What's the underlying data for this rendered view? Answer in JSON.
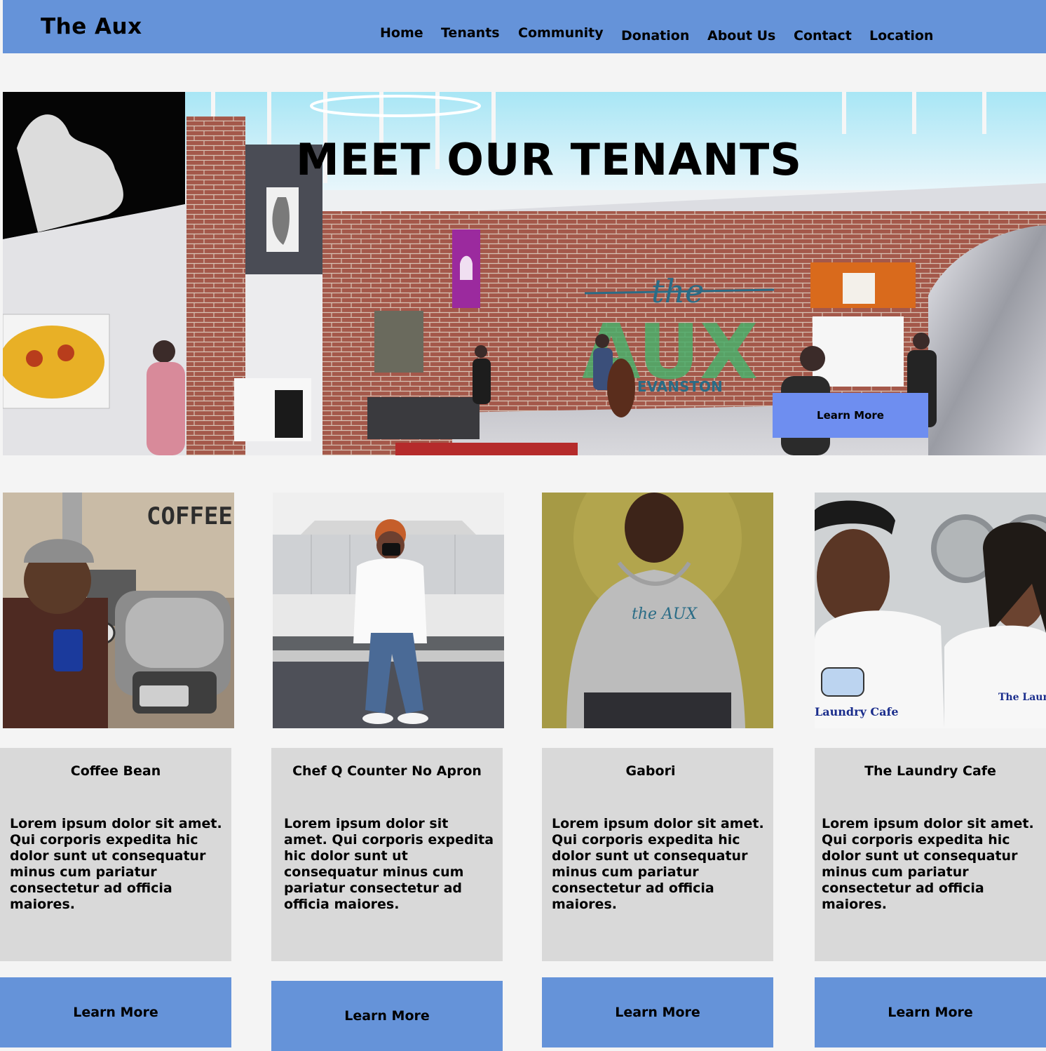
{
  "navbar": {
    "brand": "The Aux",
    "links": [
      "Home",
      "Tenants",
      "Community",
      "Donation",
      "About Us",
      "Contact",
      "Location"
    ]
  },
  "hero": {
    "title": "MEET OUR TENANTS",
    "button_label": "Learn More",
    "signage_text": "the AUX EVANSTON"
  },
  "tenants": [
    {
      "name": "Coffee Bean",
      "description": "Lorem ipsum dolor sit amet. Qui corporis expedita hic dolor sunt ut consequatur minus cum pariatur consectetur ad officia maiores.",
      "button_label": "Learn More",
      "photo_text": "COFFEE RANG"
    },
    {
      "name": "Chef Q Counter No Apron",
      "description": "Lorem ipsum dolor sit amet. Qui corporis expedita hic dolor sunt ut consequatur minus cum pariatur consectetur ad officia maiores.",
      "button_label": "Learn More"
    },
    {
      "name": "Gabori",
      "description": "Lorem ipsum dolor sit amet. Qui corporis expedita hic dolor sunt ut consequatur minus cum pariatur consectetur ad officia maiores.",
      "button_label": "Learn More",
      "photo_text": "the AUX"
    },
    {
      "name": "The Laundry Cafe",
      "description": "Lorem ipsum dolor sit amet. Qui corporis expedita hic dolor sunt ut consequatur minus cum pariatur consectetur ad officia maiores.",
      "button_label": "Learn More",
      "photo_text_left": "Laundry Cafe",
      "photo_text_right": "The Laund"
    }
  ],
  "colors": {
    "navbar": "#6593d9",
    "hero_button": "#6e8ef0",
    "card_background": "#d9d9d9",
    "page_background": "#f4f4f4"
  }
}
